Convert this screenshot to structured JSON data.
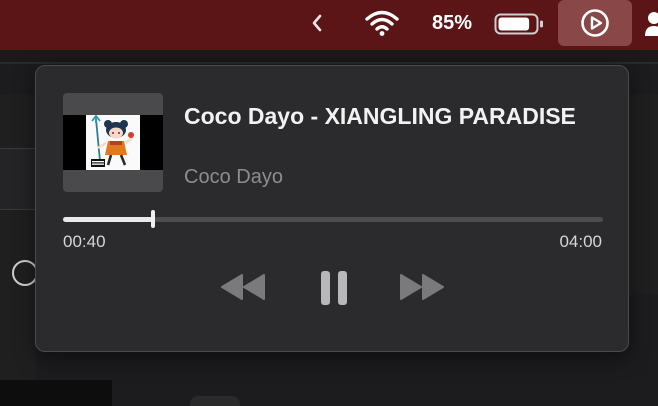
{
  "menubar": {
    "battery_percent": "85%",
    "battery_level": 0.85,
    "background_color": "#5b1516",
    "icons": [
      "chevron-left-icon",
      "wifi-icon",
      "battery-icon",
      "play-circle-icon",
      "user-icon"
    ]
  },
  "now_playing": {
    "title": "Coco Dayo - XIANGLING PARADISE",
    "artist": "Coco Dayo",
    "current_time": "00:40",
    "duration": "04:00",
    "progress": 0.167,
    "controls": [
      "rewind-icon",
      "pause-icon",
      "fast-forward-icon"
    ]
  }
}
